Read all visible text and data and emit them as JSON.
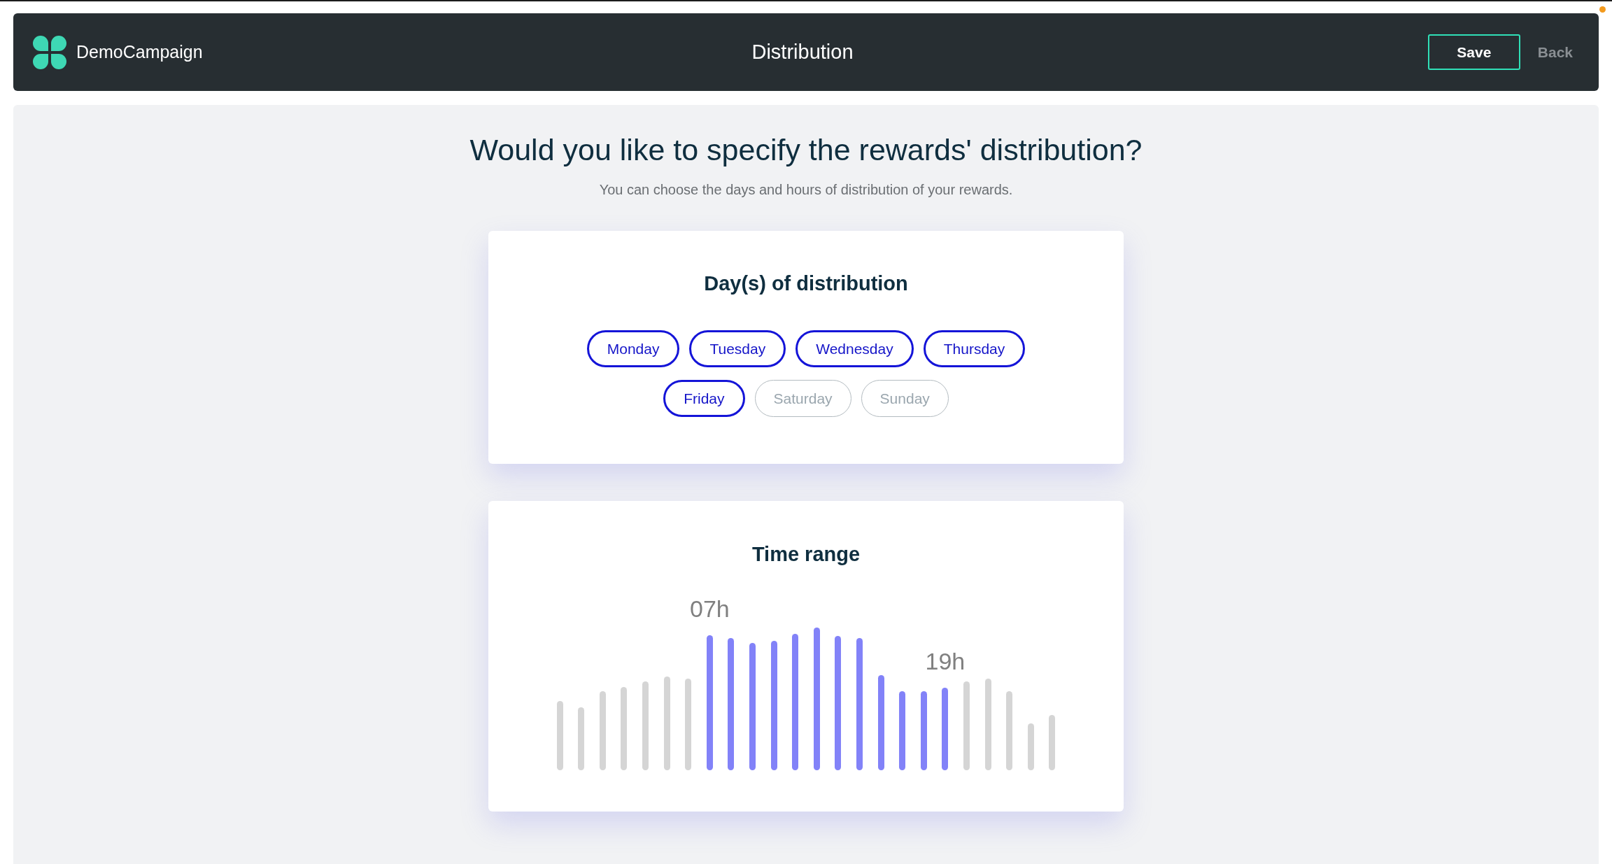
{
  "header": {
    "app_name": "DemoCampaign",
    "title": "Distribution",
    "buttons": [
      {
        "label": "Save",
        "kind": "primary"
      },
      {
        "label": "Back",
        "kind": "text"
      }
    ]
  },
  "intro": {
    "heading": "Would you like to specify the rewards' distribution?",
    "subtitle": "You can choose the days and hours of distribution of your rewards."
  },
  "days_card": {
    "title": "Day(s) of distribution",
    "days": [
      {
        "label": "Monday",
        "selected": true
      },
      {
        "label": "Tuesday",
        "selected": true
      },
      {
        "label": "Wednesday",
        "selected": true
      },
      {
        "label": "Thursday",
        "selected": true
      },
      {
        "label": "Friday",
        "selected": true
      },
      {
        "label": "Saturday",
        "selected": false
      },
      {
        "label": "Sunday",
        "selected": false
      }
    ]
  },
  "time_range_card": {
    "title": "Time range",
    "start_label": "07h",
    "end_label": "19h",
    "hours": [
      {
        "selected": false
      },
      {
        "selected": false
      },
      {
        "selected": false
      },
      {
        "selected": false
      },
      {
        "selected": false
      },
      {
        "selected": false
      },
      {
        "selected": false
      },
      {
        "selected": true
      },
      {
        "selected": true
      },
      {
        "selected": true
      },
      {
        "selected": true
      },
      {
        "selected": true
      },
      {
        "selected": true
      },
      {
        "selected": true
      },
      {
        "selected": true
      },
      {
        "selected": true
      },
      {
        "selected": true
      },
      {
        "selected": true
      },
      {
        "selected": true
      },
      {
        "selected": false
      },
      {
        "selected": false
      },
      {
        "selected": false
      },
      {
        "selected": false
      },
      {
        "selected": false
      }
    ]
  }
}
